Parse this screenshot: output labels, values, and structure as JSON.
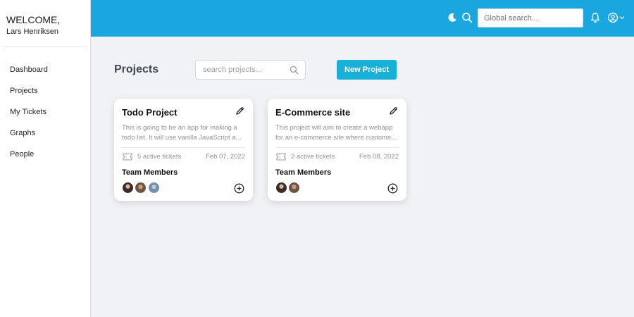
{
  "sidebar": {
    "welcome_title": "WELCOME,",
    "user_name": "Lars Henriksen",
    "items": [
      {
        "label": "Dashboard"
      },
      {
        "label": "Projects"
      },
      {
        "label": "My Tickets"
      },
      {
        "label": "Graphs"
      },
      {
        "label": "People"
      }
    ]
  },
  "topbar": {
    "background": "#1aa6de",
    "global_search_placeholder": "Global search...",
    "icons": [
      "moon-icon",
      "search-icon",
      "bell-icon",
      "user-circle-icon",
      "chevron-down-icon"
    ]
  },
  "main": {
    "title": "Projects",
    "search_placeholder": "search projects...",
    "new_button_label": "New Project",
    "accent": "#17b1d8"
  },
  "projects": [
    {
      "title": "Todo Project",
      "description_lines": [
        "This is going to be an app for making a",
        "todo list. It will use vanilla JavaScript a..."
      ],
      "tickets": "5 active tickets",
      "date": "Feb 07, 2022",
      "team_label": "Team Members",
      "members": 3
    },
    {
      "title": "E-Commerce site",
      "description_lines": [
        "This project will aim to create a webapp",
        "for an e-commerce site where custome..."
      ],
      "tickets": "2 active tickets",
      "date": "Feb 08, 2022",
      "team_label": "Team Members",
      "members": 2
    }
  ]
}
